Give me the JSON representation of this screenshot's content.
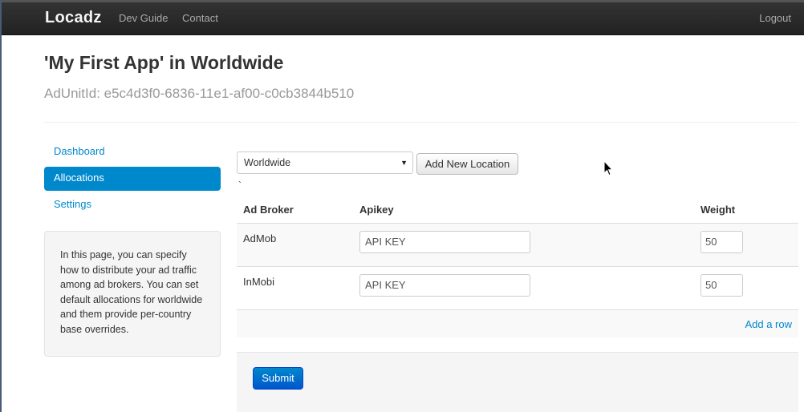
{
  "navbar": {
    "brand": "Locadz",
    "links": [
      "Dev Guide",
      "Contact"
    ],
    "logout": "Logout"
  },
  "header": {
    "title": "'My First App' in Worldwide",
    "subtitle": "AdUnitId: e5c4d3f0-6836-11e1-af00-c0cb3844b510"
  },
  "sidebar": {
    "items": [
      {
        "label": "Dashboard",
        "active": false
      },
      {
        "label": "Allocations",
        "active": true
      },
      {
        "label": "Settings",
        "active": false
      }
    ],
    "help_text": "In this page, you can specify how to distribute your ad traffic among ad brokers. You can set default allocations for worldwide and them provide per-country base overrides."
  },
  "location": {
    "selected": "Worldwide",
    "add_button": "Add New Location",
    "stray_mark": "`"
  },
  "table": {
    "headers": [
      "Ad Broker",
      "Apikey",
      "Weight"
    ],
    "rows": [
      {
        "broker": "AdMob",
        "apikey": "API KEY",
        "weight": "50"
      },
      {
        "broker": "InMobi",
        "apikey": "API KEY",
        "weight": "50"
      }
    ],
    "add_row": "Add a row"
  },
  "form": {
    "submit": "Submit"
  },
  "colors": {
    "accent": "#0088cc",
    "navbar": "#222222"
  }
}
